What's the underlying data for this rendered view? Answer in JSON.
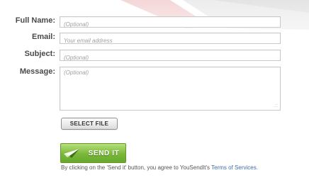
{
  "form": {
    "full_name": {
      "label": "Full Name:",
      "placeholder": "(Optional)"
    },
    "email": {
      "label": "Email:",
      "placeholder": "Your email address"
    },
    "subject": {
      "label": "Subject:",
      "placeholder": "(Optional)"
    },
    "message": {
      "label": "Message:",
      "placeholder": "(Optional)"
    },
    "select_file_label": "SELECT FILE",
    "send_label": "SEND IT",
    "agreement_text": "By clicking on the 'Send it' button, you agree to YouSendIt's ",
    "terms_link": "Terms of Services",
    "terms_suffix": "."
  },
  "colors": {
    "accent_green": "#7ab839",
    "link_blue": "#3a6fa8",
    "swoosh_red": "#e9b1b4",
    "swoosh_gray": "#d9d9d9"
  },
  "icons": {
    "send": "paper-plane-icon",
    "resize": "resize-grip-icon"
  }
}
